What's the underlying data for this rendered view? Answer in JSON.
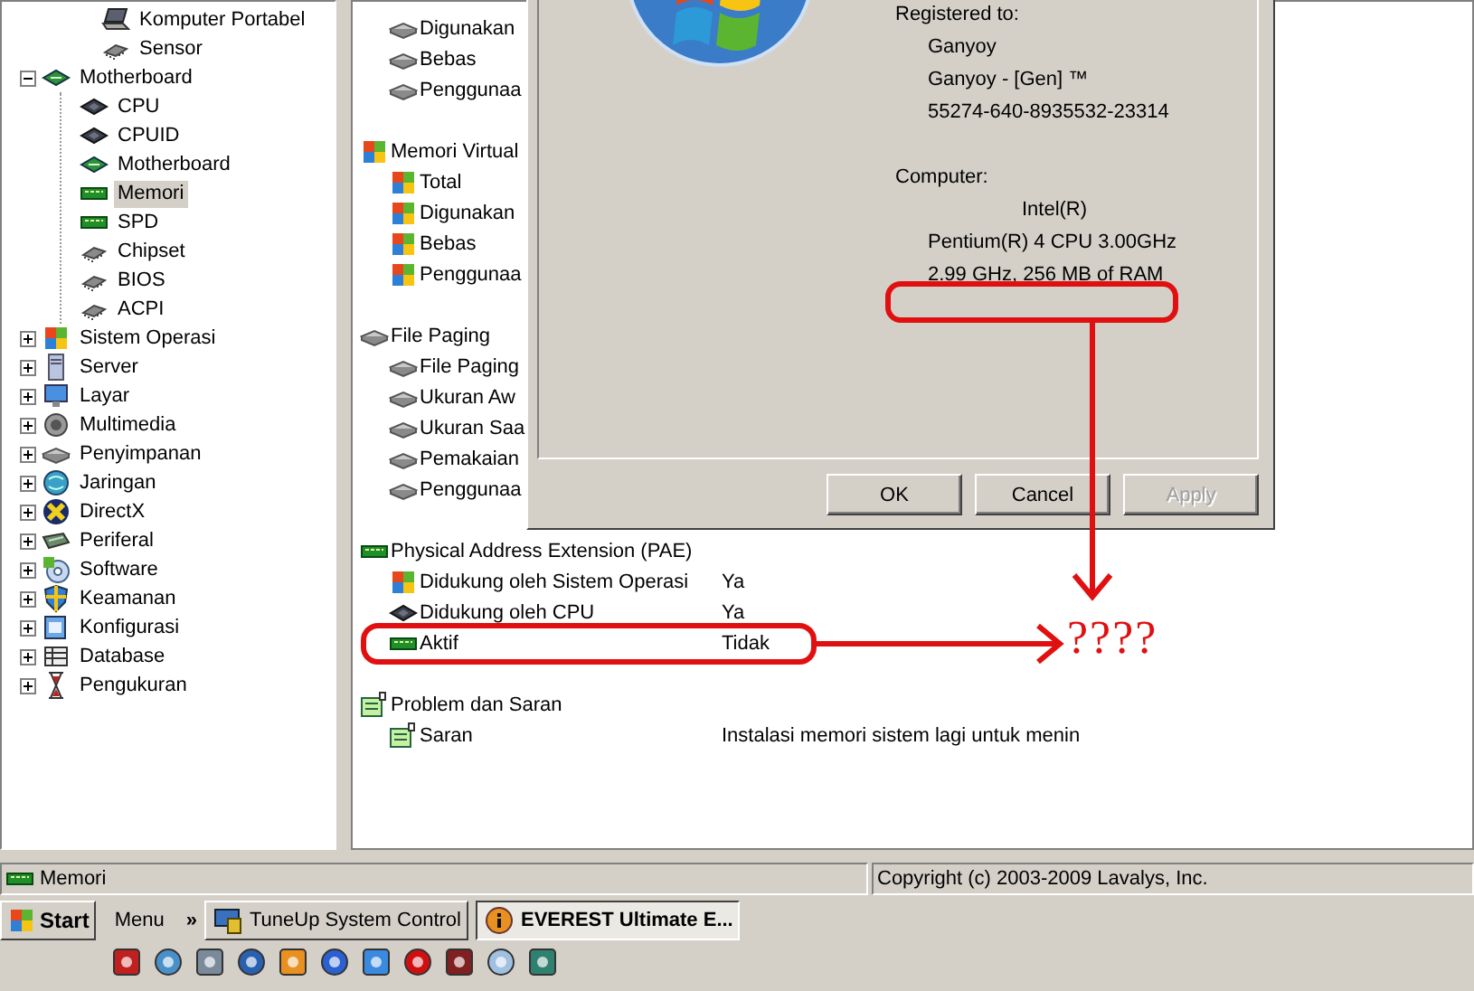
{
  "tree": {
    "hidden_parent_children": [
      {
        "label": "Komputer Portabel",
        "kind": "laptop",
        "selected": false
      },
      {
        "label": "Sensor",
        "kind": "chip",
        "selected": false
      }
    ],
    "items": [
      {
        "label": "Motherboard",
        "kind": "board",
        "expanded": true,
        "selected": false,
        "children": [
          {
            "label": "CPU",
            "kind": "cpu",
            "selected": false
          },
          {
            "label": "CPUID",
            "kind": "cpu",
            "selected": false
          },
          {
            "label": "Motherboard",
            "kind": "board",
            "selected": false
          },
          {
            "label": "Memori",
            "kind": "ram",
            "selected": true
          },
          {
            "label": "SPD",
            "kind": "ram",
            "selected": false
          },
          {
            "label": "Chipset",
            "kind": "chip",
            "selected": false
          },
          {
            "label": "BIOS",
            "kind": "chip",
            "selected": false
          },
          {
            "label": "ACPI",
            "kind": "chip",
            "selected": false
          }
        ]
      },
      {
        "label": "Sistem Operasi",
        "kind": "windows",
        "expanded": false,
        "selected": false
      },
      {
        "label": "Server",
        "kind": "server",
        "expanded": false,
        "selected": false
      },
      {
        "label": "Layar",
        "kind": "monitor",
        "expanded": false,
        "selected": false
      },
      {
        "label": "Multimedia",
        "kind": "speaker",
        "expanded": false,
        "selected": false
      },
      {
        "label": "Penyimpanan",
        "kind": "disk",
        "expanded": false,
        "selected": false
      },
      {
        "label": "Jaringan",
        "kind": "network",
        "expanded": false,
        "selected": false
      },
      {
        "label": "DirectX",
        "kind": "directx",
        "expanded": false,
        "selected": false
      },
      {
        "label": "Periferal",
        "kind": "peripheral",
        "expanded": false,
        "selected": false
      },
      {
        "label": "Software",
        "kind": "software",
        "expanded": false,
        "selected": false
      },
      {
        "label": "Keamanan",
        "kind": "shield",
        "expanded": false,
        "selected": false
      },
      {
        "label": "Konfigurasi",
        "kind": "config",
        "expanded": false,
        "selected": false
      },
      {
        "label": "Database",
        "kind": "database",
        "expanded": false,
        "selected": false
      },
      {
        "label": "Pengukuran",
        "kind": "hourglass",
        "expanded": false,
        "selected": false
      }
    ]
  },
  "list": {
    "sections": [
      {
        "rows": [
          {
            "label": "Digunakan",
            "kind": "disk"
          },
          {
            "label": "Bebas",
            "kind": "disk"
          },
          {
            "label": "Penggunaa",
            "kind": "disk"
          }
        ]
      },
      {
        "label": "Memori Virtual",
        "kind": "windows",
        "rows": [
          {
            "label": "Total",
            "kind": "windows"
          },
          {
            "label": "Digunakan",
            "kind": "windows"
          },
          {
            "label": "Bebas",
            "kind": "windows"
          },
          {
            "label": "Penggunaa",
            "kind": "windows"
          }
        ]
      },
      {
        "label": "File Paging",
        "kind": "disk",
        "rows": [
          {
            "label": "File Paging",
            "kind": "disk"
          },
          {
            "label": "Ukuran Aw",
            "kind": "disk"
          },
          {
            "label": "Ukuran Saa",
            "kind": "disk"
          },
          {
            "label": "Pemakaian",
            "kind": "disk"
          },
          {
            "label": "Penggunaa",
            "kind": "disk"
          }
        ]
      },
      {
        "label": "Physical Address Extension (PAE)",
        "kind": "ram",
        "rows": [
          {
            "label": "Didukung oleh Sistem Operasi",
            "kind": "windows",
            "value": "Ya"
          },
          {
            "label": "Didukung oleh CPU",
            "kind": "cpu",
            "value": "Ya"
          },
          {
            "label": "Aktif",
            "kind": "ram",
            "value": "Tidak"
          }
        ]
      },
      {
        "label": "Problem dan Saran",
        "kind": "note",
        "rows": [
          {
            "label": "Saran",
            "kind": "note",
            "value": "Instalasi memori sistem lagi untuk menin"
          }
        ]
      }
    ]
  },
  "dialog": {
    "registered_label": "Registered to:",
    "registered": [
      "Ganyoy",
      "Ganyoy - [Gen] ™",
      "55274-640-8935532-23314"
    ],
    "computer_label": "Computer:",
    "computer": [
      {
        "text": "Intel(R)",
        "kind": "centered"
      },
      {
        "text": "Pentium(R) 4 CPU 3.00GHz",
        "kind": "plain"
      },
      {
        "text": "2.99 GHz, 256 MB of RAM",
        "kind": "plain"
      }
    ],
    "buttons": [
      {
        "label": "OK",
        "disabled": false
      },
      {
        "label": "Cancel",
        "disabled": false
      },
      {
        "label": "Apply",
        "disabled": true
      }
    ]
  },
  "annotation": {
    "text": "????"
  },
  "status_bar": {
    "panels": [
      {
        "text": "Memori",
        "kind": "ram"
      },
      {
        "text": "Copyright (c) 2003-2009 Lavalys, Inc."
      }
    ]
  },
  "taskbar": {
    "start": "Start",
    "menu": "Menu",
    "chevron": "»",
    "tasks": [
      {
        "label": "TuneUp System Control",
        "kind": "tuneup",
        "selected": false
      },
      {
        "label": "EVEREST Ultimate E...",
        "kind": "info",
        "selected": true
      }
    ]
  }
}
